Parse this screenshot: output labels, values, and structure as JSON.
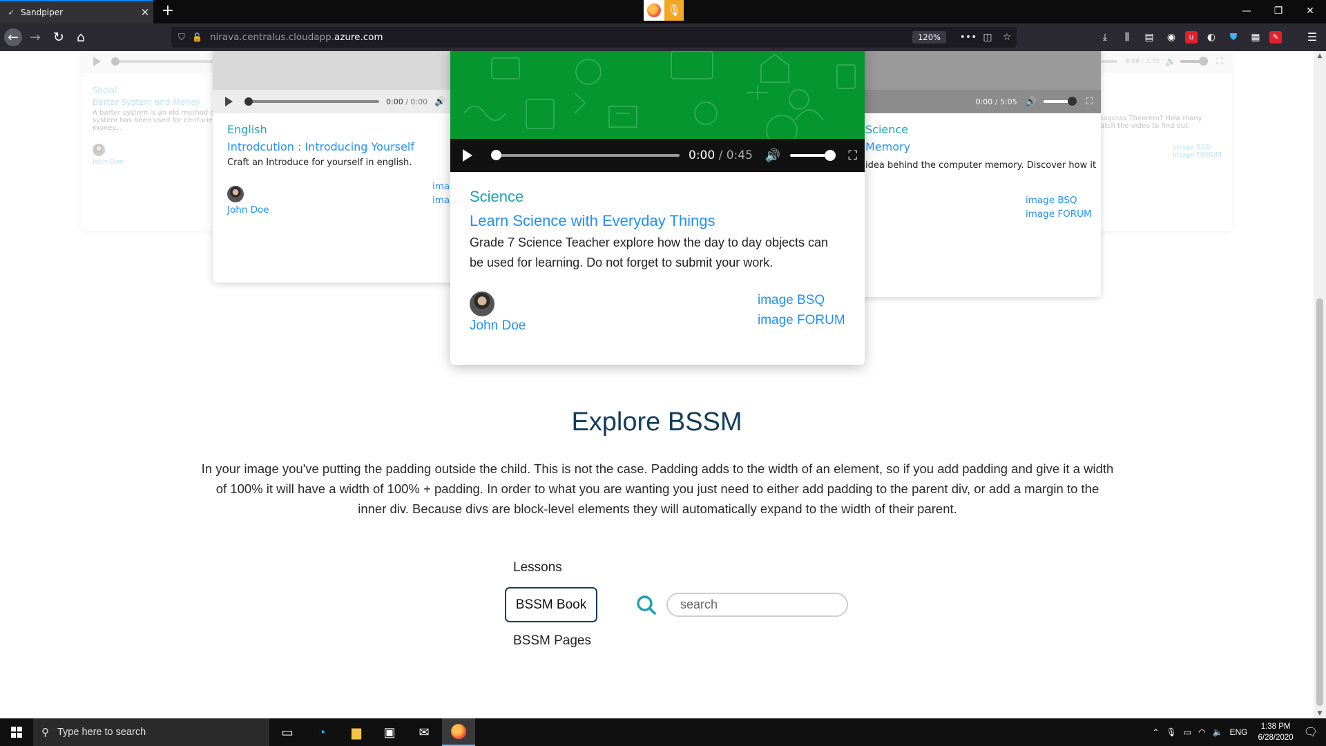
{
  "browser": {
    "tab_title": "Sandpiper",
    "tab_close": "✕",
    "new_tab": "+",
    "url_domain": "nirava.centralus.",
    "url_host": "cloudapp.",
    "url_tld": "azure.com",
    "zoom": "120%",
    "window_controls": [
      "—",
      "❐",
      "✕"
    ]
  },
  "cards": {
    "far_left": {
      "subject": "Social",
      "title": "Barter System and Money",
      "desc": "A barter system is an old method of exchange. This system has been used for centuries and long before money...",
      "author": "John Doe"
    },
    "left": {
      "time": "0:00",
      "duration": "/ 0:00",
      "subject": "English",
      "title": "Introdcution : Introducing Yourself",
      "desc": "Craft an Introduce for yourself in english.",
      "author": "John Doe",
      "link1": "image BSQ",
      "link2": "image FORUM"
    },
    "main": {
      "time": "0:00",
      "duration": "/ 0:45",
      "subject": "Science",
      "title": "Learn Science with Everyday Things",
      "desc": "Grade 7 Science Teacher explore how the day to day objects can be used for learning. Do not forget to submit your work.",
      "author": "John Doe",
      "link1": "image BSQ",
      "link2": "image FORUM"
    },
    "right": {
      "time": "0:00",
      "duration": "/ 5:05",
      "subject": "Science",
      "title": "Memory",
      "desc": "idea behind the computer memory. Discover how it",
      "link1": "image BSQ",
      "link2": "image FORUM"
    },
    "far_right": {
      "time": "0:00",
      "duration": "/ 3:56",
      "desc": "Do you know what is Pythagoras Theorem? How many ways you can solve it? Watch the video to find out.",
      "link1": "image BSQ",
      "link2": "image FORUM"
    }
  },
  "explore": {
    "title": "Explore BSSM",
    "text": "In your image you've putting the padding outside the child. This is not the case. Padding adds to the width of an element, so if you add padding and give it a width of 100% it will have a width of 100% + padding. In order to what you are wanting you just need to either add padding to the parent div, or add a margin to the inner div. Because divs are block-level elements they will automatically expand to the width of their parent.",
    "nav_lessons": "Lessons",
    "nav_book": "BSSM Book",
    "nav_pages": "BSSM Pages",
    "search_placeholder": "search"
  },
  "taskbar": {
    "search_placeholder": "Type here to search",
    "language": "ENG",
    "time": "1:38 PM",
    "date": "6/28/2020"
  },
  "colors": {
    "accent_teal": "#1aa3b4",
    "link_blue": "#1e90ff",
    "heading_navy": "#123d5a",
    "card_image_green": "#06962e"
  }
}
